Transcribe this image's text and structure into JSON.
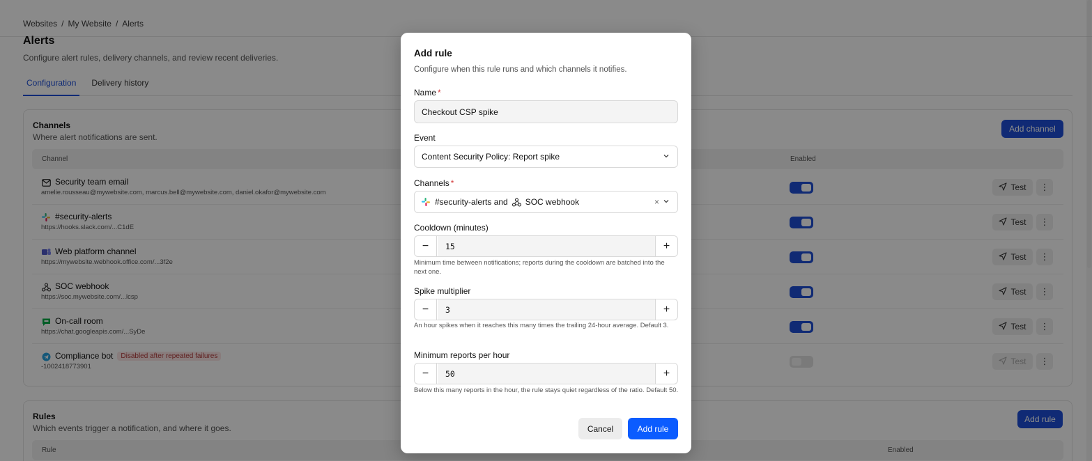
{
  "breadcrumb": [
    "Websites",
    "/",
    "My Website",
    "/",
    "Alerts"
  ],
  "page": {
    "title": "Alerts",
    "subtitle": "Configure alert rules, delivery channels, and review recent deliveries."
  },
  "tabs": [
    "Configuration",
    "Delivery history"
  ],
  "channels": {
    "title": "Channels",
    "subtitle": "Where alert notifications are sent.",
    "add_label": "Add channel",
    "col_channel": "Channel",
    "col_enabled": "Enabled",
    "test_label": "Test",
    "rows": [
      {
        "name": "Security team email",
        "detail": "amelie.rousseau@mywebsite.com, marcus.bell@mywebsite.com, daniel.okafor@mywebsite.com",
        "icon": "mail-icon",
        "enabled": true
      },
      {
        "name": "#security-alerts",
        "detail": "https://hooks.slack.com/...C1dE",
        "icon": "slack-icon",
        "enabled": true
      },
      {
        "name": "Web platform channel",
        "detail": "https://mywebsite.webhook.office.com/...3f2e",
        "icon": "teams-icon",
        "enabled": true
      },
      {
        "name": "SOC webhook",
        "detail": "https://soc.mywebsite.com/...lcsp",
        "icon": "webhook-icon",
        "enabled": true
      },
      {
        "name": "On-call room",
        "detail": "https://chat.googleapis.com/...SyDe",
        "icon": "google-chat-icon",
        "enabled": true
      },
      {
        "name": "Compliance bot",
        "detail": "-1002418773901",
        "icon": "telegram-icon",
        "enabled": false,
        "badge": "Disabled after repeated failures"
      }
    ]
  },
  "rules": {
    "title": "Rules",
    "subtitle": "Which events trigger a notification, and where it goes.",
    "add_label": "Add rule",
    "col_rule": "Rule",
    "col_enabled": "Enabled"
  },
  "modal": {
    "title": "Add rule",
    "subtitle": "Configure when this rule runs and which channels it notifies.",
    "name_label": "Name",
    "name_value": "Checkout CSP spike",
    "event_label": "Event",
    "event_value": "Content Security Policy: Report spike",
    "channels_label": "Channels",
    "channels_first": "#security-alerts and",
    "channels_second": "SOC webhook",
    "clear_glyph": "×",
    "cooldown_label": "Cooldown (minutes)",
    "cooldown_value": "15",
    "cooldown_help": "Minimum time between notifications; reports during the cooldown are batched into the next one.",
    "spike_label": "Spike multiplier",
    "spike_value": "3",
    "spike_help": "An hour spikes when it reaches this many times the trailing 24-hour average. Default 3.",
    "min_label": "Minimum reports per hour",
    "min_value": "50",
    "min_help": "Below this many reports in the hour, the rule stays quiet regardless of the ratio. Default 50.",
    "minus_glyph": "−",
    "plus_glyph": "+",
    "cancel_label": "Cancel",
    "submit_label": "Add rule"
  },
  "colors": {
    "accent": "#1e4fd8",
    "submit": "#0b5cff",
    "required": "#d43a3a",
    "badge_text": "#b23b3b",
    "badge_bg": "#fbe5e5"
  }
}
